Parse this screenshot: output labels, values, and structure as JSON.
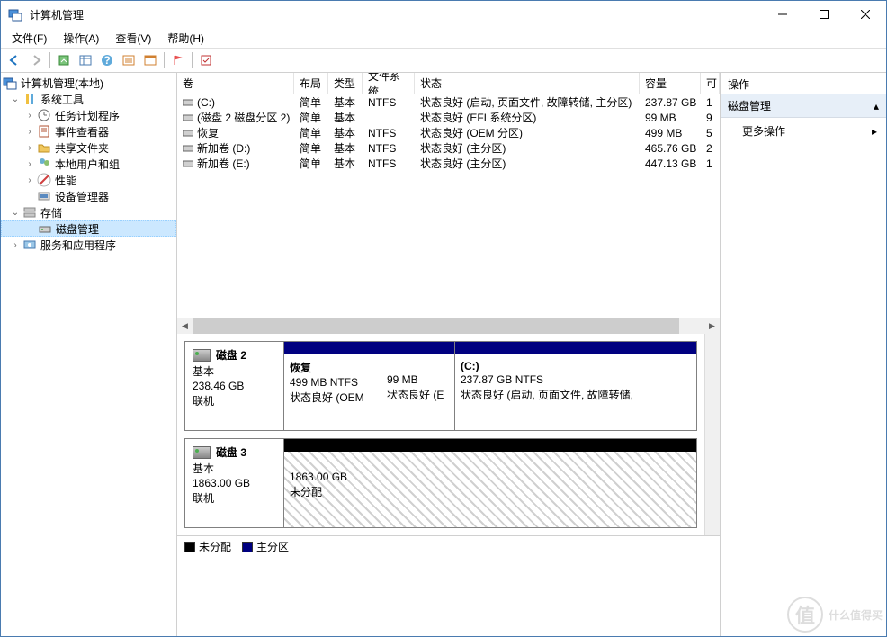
{
  "window": {
    "title": "计算机管理"
  },
  "menu": {
    "file": "文件(F)",
    "action": "操作(A)",
    "view": "查看(V)",
    "help": "帮助(H)"
  },
  "tree": {
    "root": "计算机管理(本地)",
    "systools": "系统工具",
    "task_sched": "任务计划程序",
    "event_viewer": "事件查看器",
    "shared_folders": "共享文件夹",
    "local_users": "本地用户和组",
    "performance": "性能",
    "dev_mgr": "设备管理器",
    "storage": "存储",
    "disk_mgmt": "磁盘管理",
    "services_apps": "服务和应用程序"
  },
  "cols": {
    "volume": "卷",
    "layout": "布局",
    "type": "类型",
    "fs": "文件系统",
    "status": "状态",
    "capacity": "容量",
    "free": "可"
  },
  "vols": [
    {
      "name": "(C:)",
      "layout": "简单",
      "type": "基本",
      "fs": "NTFS",
      "status": "状态良好 (启动, 页面文件, 故障转储, 主分区)",
      "capacity": "237.87 GB",
      "free": "1"
    },
    {
      "name": "(磁盘 2 磁盘分区 2)",
      "layout": "简单",
      "type": "基本",
      "fs": "",
      "status": "状态良好 (EFI 系统分区)",
      "capacity": "99 MB",
      "free": "9"
    },
    {
      "name": "恢复",
      "layout": "简单",
      "type": "基本",
      "fs": "NTFS",
      "status": "状态良好 (OEM 分区)",
      "capacity": "499 MB",
      "free": "5"
    },
    {
      "name": "新加卷 (D:)",
      "layout": "简单",
      "type": "基本",
      "fs": "NTFS",
      "status": "状态良好 (主分区)",
      "capacity": "465.76 GB",
      "free": "2"
    },
    {
      "name": "新加卷 (E:)",
      "layout": "简单",
      "type": "基本",
      "fs": "NTFS",
      "status": "状态良好 (主分区)",
      "capacity": "447.13 GB",
      "free": "1"
    }
  ],
  "disk2": {
    "title": "磁盘 2",
    "type": "基本",
    "size": "238.46 GB",
    "online": "联机",
    "p1_name": "恢复",
    "p1_size": "499 MB NTFS",
    "p1_status": "状态良好 (OEM",
    "p2_size": "99 MB",
    "p2_status": "状态良好 (E",
    "p3_name": "(C:)",
    "p3_size": "237.87 GB NTFS",
    "p3_status": "状态良好 (启动, 页面文件, 故障转储,"
  },
  "disk3": {
    "title": "磁盘 3",
    "type": "基本",
    "size": "1863.00 GB",
    "online": "联机",
    "p1_size": "1863.00 GB",
    "p1_status": "未分配"
  },
  "legend": {
    "unalloc": "未分配",
    "primary": "主分区"
  },
  "actions": {
    "header": "操作",
    "disk_mgmt": "磁盘管理",
    "more": "更多操作"
  },
  "watermark": {
    "circ": "值",
    "text": "什么值得买"
  }
}
